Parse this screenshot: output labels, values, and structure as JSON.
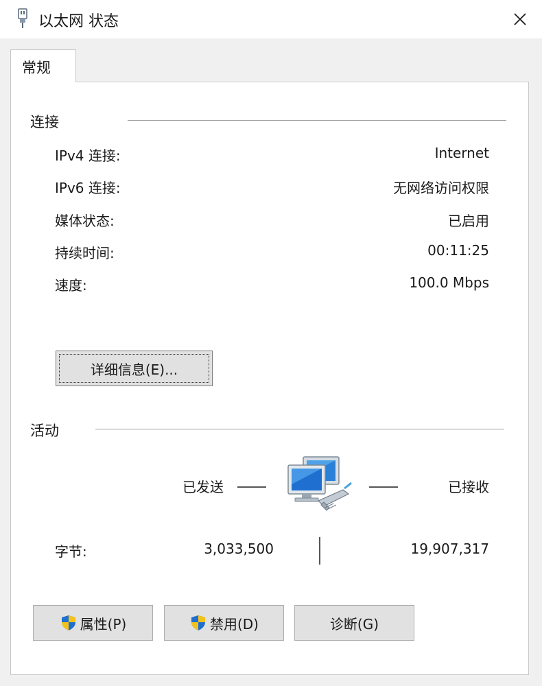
{
  "window": {
    "title": "以太网 状态",
    "app_icon": "network-adapter-icon",
    "close_icon": "close-icon"
  },
  "tab": {
    "label": "常规"
  },
  "connection": {
    "title": "连接",
    "rows": [
      {
        "label": "IPv4 连接:",
        "value": "Internet"
      },
      {
        "label": "IPv6 连接:",
        "value": "无网络访问权限"
      },
      {
        "label": "媒体状态:",
        "value": "已启用"
      },
      {
        "label": "持续时间:",
        "value": "00:11:25"
      },
      {
        "label": "速度:",
        "value": "100.0 Mbps"
      }
    ],
    "details_button": "详细信息(E)..."
  },
  "activity": {
    "title": "活动",
    "sent_label": "已发送",
    "received_label": "已接收",
    "network_icon": "network-computers-icon",
    "bytes_label": "字节:",
    "bytes_sent": "3,033,500",
    "bytes_received": "19,907,317"
  },
  "buttons": {
    "properties": "属性(P)",
    "disable": "禁用(D)",
    "diagnose": "诊断(G)",
    "shield_icon": "uac-shield-icon"
  },
  "colors": {
    "client_bg": "#f0f0f0",
    "panel_bg": "#ffffff",
    "button_bg": "#e1e1e1",
    "shield_blue": "#1f6fd1",
    "shield_yellow": "#f5c21b"
  }
}
